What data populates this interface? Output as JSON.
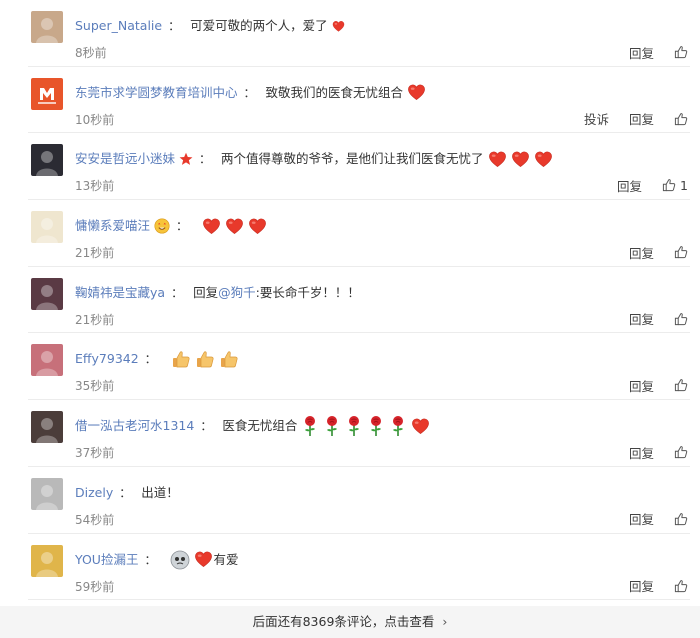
{
  "comments": [
    {
      "user": "Super_Natalie",
      "colon": "：",
      "text": "可爱可敬的两个人，爱了",
      "time": "8秒前",
      "reply": "回复",
      "report": "",
      "likes": "",
      "avatar_color": "#c8a88a",
      "emoji": [
        "heart-small"
      ]
    },
    {
      "user": "东莞市求学圆梦教育培训中心",
      "colon": "：",
      "text": "致敬我们的医食无忧组合",
      "time": "10秒前",
      "reply": "回复",
      "report": "投诉",
      "likes": "",
      "avatar_color": "#e8552a",
      "emoji": [
        "heart"
      ]
    },
    {
      "user": "安安是哲远小迷妹",
      "colon": "：",
      "text": "两个值得尊敬的爷爷，是他们让我们医食无忧了",
      "time": "13秒前",
      "reply": "回复",
      "report": "",
      "likes": "1",
      "avatar_color": "#2b2b33",
      "emoji": [
        "heart",
        "heart",
        "heart"
      ],
      "badge": "star"
    },
    {
      "user": "慵懒系爱喵汪",
      "colon": "：",
      "text": "",
      "time": "21秒前",
      "reply": "回复",
      "report": "",
      "likes": "",
      "avatar_color": "#efe6cf",
      "emoji": [
        "heart",
        "heart",
        "heart"
      ],
      "badge": "face"
    },
    {
      "user": "鞠婧祎是宝藏ya",
      "colon": "：",
      "text_prefix": "回复",
      "mention": "@狗千",
      "text": ":要长命千岁！！！",
      "time": "21秒前",
      "reply": "回复",
      "report": "",
      "likes": "",
      "avatar_color": "#5a3a44",
      "emoji": []
    },
    {
      "user": "Effy79342",
      "colon": "：",
      "text": "",
      "time": "35秒前",
      "reply": "回复",
      "report": "",
      "likes": "",
      "avatar_color": "#c7707a",
      "emoji": [
        "thumb",
        "thumb",
        "thumb"
      ]
    },
    {
      "user": "借一泓古老河水1314",
      "colon": "：",
      "text": "医食无忧组合",
      "time": "37秒前",
      "reply": "回复",
      "report": "",
      "likes": "",
      "avatar_color": "#4b3d3a",
      "emoji": [
        "rose",
        "rose",
        "rose",
        "rose",
        "rose",
        "heart"
      ]
    },
    {
      "user": "Dizely",
      "colon": "：",
      "text": "出道！",
      "time": "54秒前",
      "reply": "回复",
      "report": "",
      "likes": "",
      "avatar_color": "#b9b9b9",
      "emoji": []
    },
    {
      "user": "YOU捡漏王",
      "colon": "：",
      "text": "有爱",
      "time": "59秒前",
      "reply": "回复",
      "report": "",
      "likes": "",
      "avatar_color": "#e0b54a",
      "emoji": [
        "sticker",
        "heart"
      ],
      "emoji_before_text": true
    }
  ],
  "footer": {
    "text": "后面还有8369条评论，点击查看"
  },
  "colors": {
    "link": "#5b7dbb",
    "heart": "#e8392b",
    "time": "#888888"
  }
}
